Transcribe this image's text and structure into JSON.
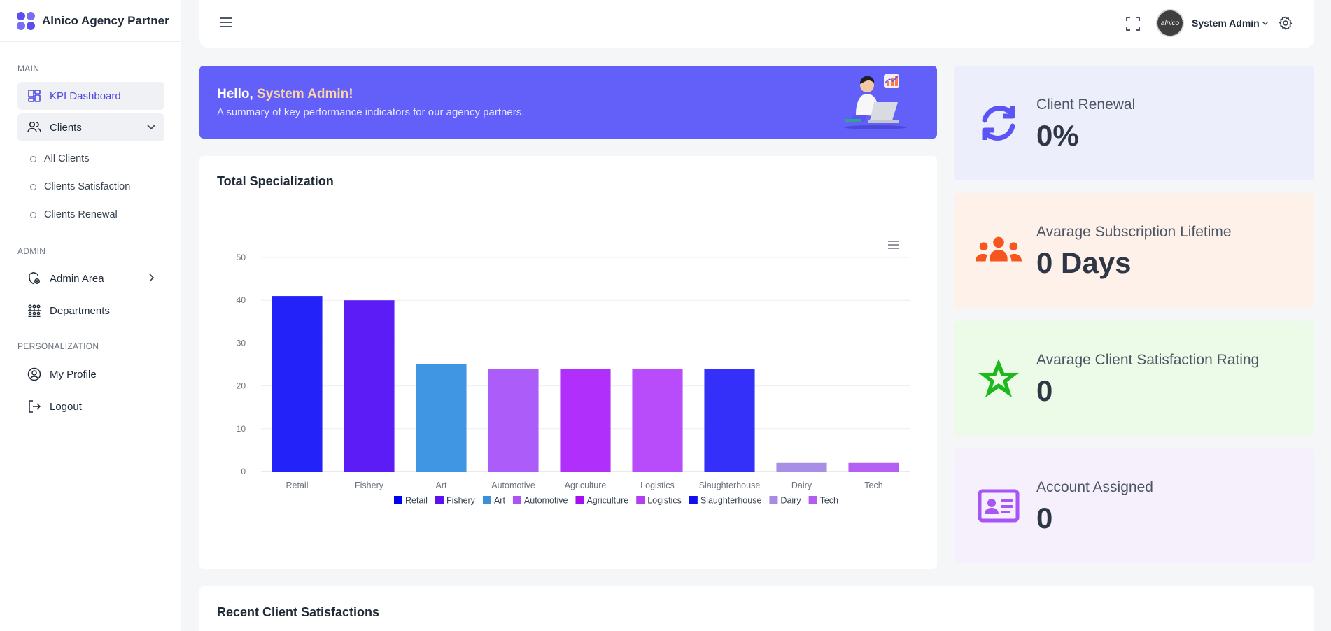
{
  "brand": {
    "name": "Alnico Agency Partner"
  },
  "sidebar": {
    "sections": {
      "main": "MAIN",
      "admin": "ADMIN",
      "personalization": "PERSONALIZATION"
    },
    "items": {
      "kpi": "KPI Dashboard",
      "clients": "Clients",
      "all_clients": "All Clients",
      "satisfaction": "Clients Satisfaction",
      "renewal": "Clients Renewal",
      "admin_area": "Admin Area",
      "departments": "Departments",
      "profile": "My Profile",
      "logout": "Logout"
    }
  },
  "header": {
    "avatar_text": "alnico",
    "user_name": "System Admin"
  },
  "banner": {
    "greeting": "Hello, ",
    "name": "System Admin!",
    "subtitle": "A summary of key performance indicators for our agency partners."
  },
  "kpis": [
    {
      "label": "Client Renewal",
      "value": "0%",
      "icon": "refresh-icon",
      "color": "#5b55f5",
      "bg": "#eceefc"
    },
    {
      "label": "Avarage Subscription Lifetime",
      "value": "0 Days",
      "icon": "users-icon",
      "color": "#f5551e",
      "bg": "#fdf1ea"
    },
    {
      "label": "Avarage Client Satisfaction Rating",
      "value": "0",
      "icon": "star-icon",
      "color": "#1cb81c",
      "bg": "#ebfbe7"
    },
    {
      "label": "Account Assigned",
      "value": "0",
      "icon": "id-card-icon",
      "color": "#a855f7",
      "bg": "#f6f0fc"
    }
  ],
  "chart_card": {
    "title": "Total Specialization"
  },
  "recent": {
    "title": "Recent Client Satisfactions"
  },
  "chart_data": {
    "type": "bar",
    "categories": [
      "Retail",
      "Fishery",
      "Art",
      "Automotive",
      "Agriculture",
      "Logistics",
      "Slaughterhouse",
      "Dairy",
      "Tech"
    ],
    "values": [
      41,
      40,
      25,
      24,
      24,
      24,
      24,
      2,
      2
    ],
    "colors": [
      "#2323f9",
      "#5b1cf5",
      "#4196e4",
      "#ac5cf8",
      "#b12ffa",
      "#b94cfa",
      "#3430fa",
      "#a98ee6",
      "#b660f3"
    ],
    "legend_colors": [
      "#0000f0",
      "#5a10f0",
      "#3d8fd6",
      "#a855f7",
      "#a50ff0",
      "#b23df4",
      "#1010ef",
      "#a78be0",
      "#b45cf0"
    ],
    "yticks": [
      0,
      10,
      20,
      30,
      40,
      50
    ],
    "ylim": [
      0,
      50
    ],
    "grid": true,
    "legend": "bottom",
    "xlabel": "",
    "ylabel": ""
  }
}
